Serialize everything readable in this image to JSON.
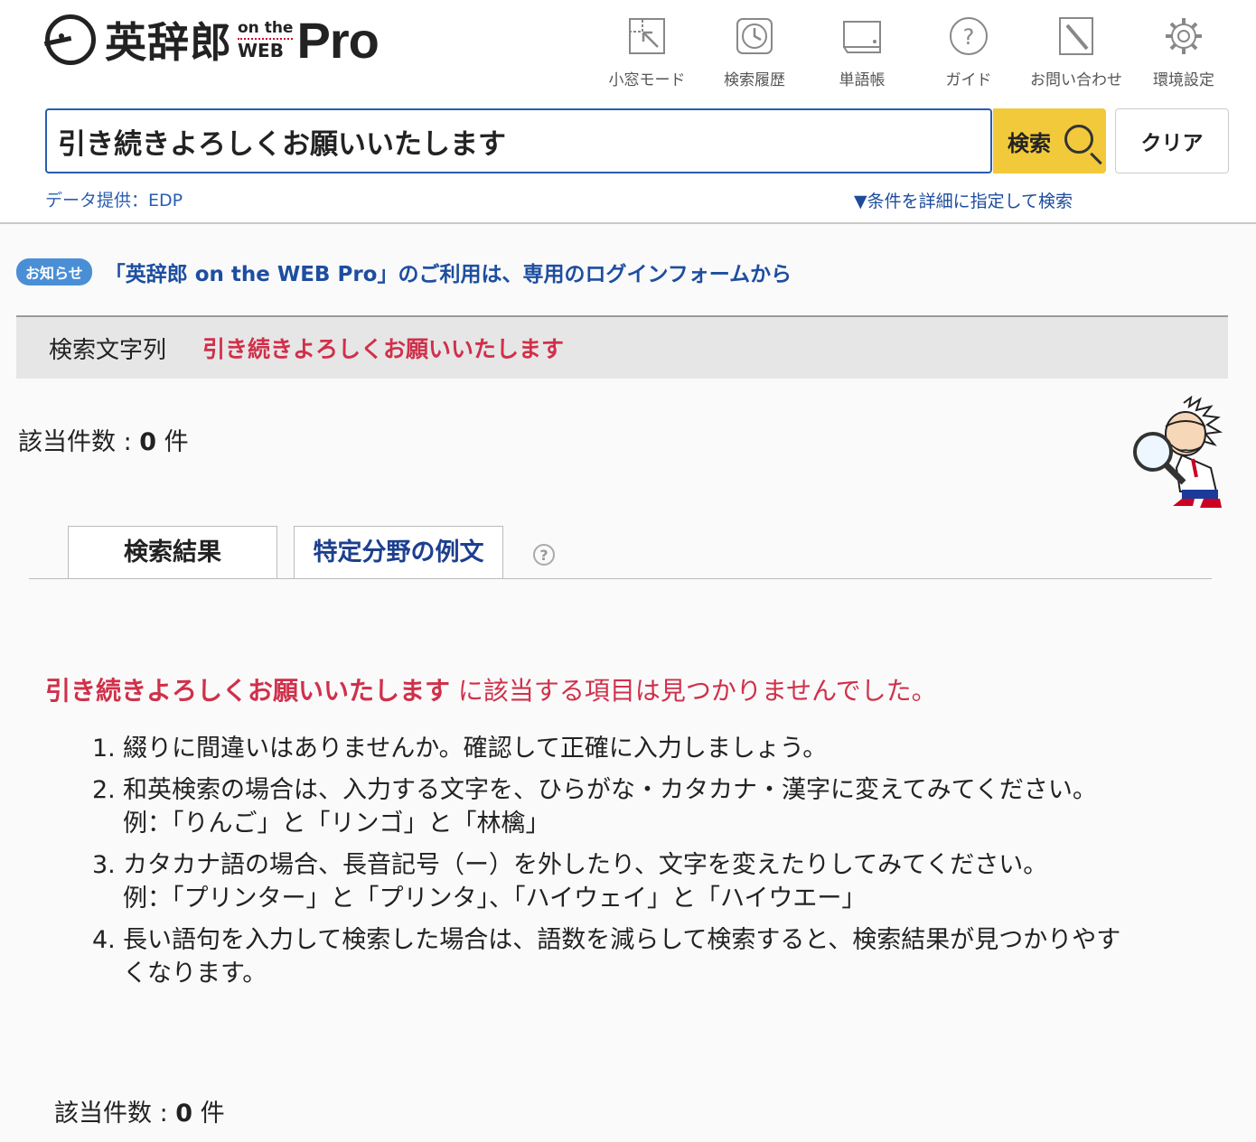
{
  "logo": {
    "kanji": "英辞郎",
    "on_the": "on the",
    "web": "WEB",
    "pro": "Pro"
  },
  "toolbar": {
    "items": [
      {
        "label": "小窓モード",
        "icon": "small-window-icon"
      },
      {
        "label": "検索履歴",
        "icon": "clock-icon"
      },
      {
        "label": "単語帳",
        "icon": "notebook-icon"
      },
      {
        "label": "ガイド",
        "icon": "question-icon"
      },
      {
        "label": "お問い合わせ",
        "icon": "pen-icon"
      },
      {
        "label": "環境設定",
        "icon": "gear-icon"
      }
    ]
  },
  "search": {
    "value": "引き続きよろしくお願いいたします",
    "button_label": "検索",
    "clear_label": "クリア"
  },
  "data_credit": "データ提供：EDP",
  "advanced_search": "▼条件を詳細に指定して検索",
  "notice": {
    "badge": "お知らせ",
    "text": "「英辞郎 on the WEB Pro」のご利用は、専用のログインフォームから"
  },
  "query_bar": {
    "label": "検索文字列",
    "value": "引き続きよろしくお願いいたします"
  },
  "hits": {
    "label": "該当件数 : ",
    "count": "0",
    "unit": " 件"
  },
  "tabs": [
    {
      "label": "検索結果",
      "active": true
    },
    {
      "label": "特定分野の例文",
      "active": false
    }
  ],
  "help_glyph": "?",
  "no_result": {
    "query": "引き続きよろしくお願いいたします",
    "message": " に該当する項目は見つかりませんでした。"
  },
  "tips": [
    {
      "num": "1.",
      "line1": "綴りに間違いはありませんか。確認して正確に入力しましょう。",
      "line2": ""
    },
    {
      "num": "2.",
      "line1": "和英検索の場合は、入力する文字を、ひらがな・カタカナ・漢字に変えてみてください。",
      "line2": "例：「りんご」と「リンゴ」と「林檎」"
    },
    {
      "num": "3.",
      "line1": "カタカナ語の場合、長音記号（ー）を外したり、文字を変えたりしてみてください。",
      "line2": "例：「プリンター」と「プリンタ」、「ハイウェイ」と「ハイウエー」"
    },
    {
      "num": "4.",
      "line1": "長い語句を入力して検索した場合は、語数を減らして検索すると、検索結果が見つかりやす",
      "line2": "くなります。"
    }
  ],
  "colors": {
    "accent_blue": "#2a5db0",
    "link_blue": "#1d4ea0",
    "highlight_red": "#d0304a",
    "search_yellow": "#f1c93b"
  }
}
